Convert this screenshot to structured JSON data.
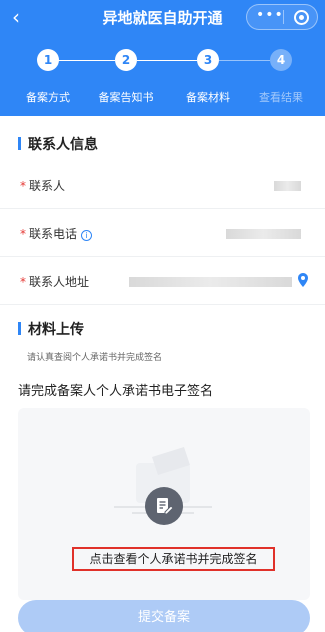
{
  "header": {
    "title": "异地就医自助开通",
    "back_icon": "chevron-left-icon",
    "capsule_icons": [
      "more-dots-icon",
      "target-icon"
    ],
    "accent_color": "#2f86f6"
  },
  "steps": [
    {
      "number": "1",
      "label": "备案方式",
      "active": true
    },
    {
      "number": "2",
      "label": "备案告知书",
      "active": true
    },
    {
      "number": "3",
      "label": "备案材料",
      "active": true
    },
    {
      "number": "4",
      "label": "查看结果",
      "active": false
    }
  ],
  "contact_section": {
    "title": "联系人信息",
    "fields": [
      {
        "label": "联系人",
        "required": true,
        "icon": null
      },
      {
        "label": "联系电话",
        "required": true,
        "icon": "info-icon"
      },
      {
        "label": "联系人地址",
        "required": true,
        "icon": "location-pin-icon"
      }
    ]
  },
  "materials_section": {
    "title": "材料上传",
    "hint": "请认真查阅个人承诺书并完成签名",
    "sign_title": "请完成备案人个人承诺书电子签名",
    "sign_link": "点击查看个人承诺书并完成签名",
    "sign_icon": "edit-document-icon"
  },
  "submit_label": "提交备案"
}
